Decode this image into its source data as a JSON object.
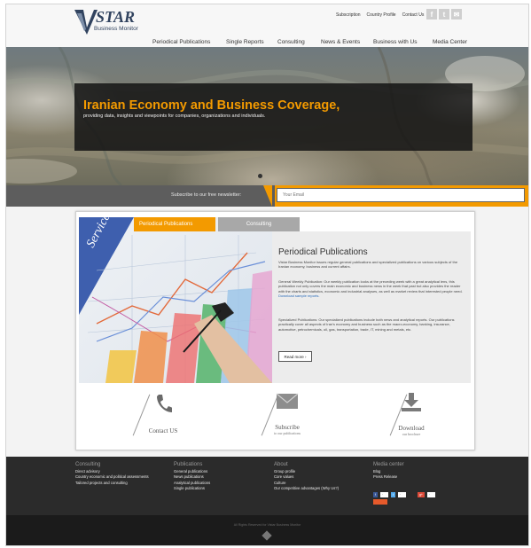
{
  "brand": {
    "logo_text": "STAR",
    "logo_sub": "Business Monitor"
  },
  "top_links": [
    "Subscription",
    "Country Profile",
    "Contact Us"
  ],
  "social_icons": [
    "facebook-icon",
    "twitter-icon",
    "email-icon"
  ],
  "nav": [
    "Periodical Publications",
    "Single Reports",
    "Consulting",
    "News & Events",
    "Business with Us",
    "Media Center"
  ],
  "hero": {
    "title": "Iranian Economy and Business Coverage,",
    "subtitle": "providing data, insights and viewpoints for companies, organizations and individuals."
  },
  "newsletter": {
    "label": "Subscribe to our free newsletter:",
    "placeholder": "Your Email"
  },
  "tabs": [
    "Periodical Publications",
    "Consulting"
  ],
  "services_label": "Services",
  "content": {
    "title": "Periodical Publications",
    "p1": "Vistar Business Monitor issues regular general publications and specialized publications on various subjects of the Iranian economy, business and current affairs.",
    "p2": "General Weekly Publication: Our weekly publication looks at the preceding week with a great analytical lens, this publication not only covers the main economic and business news in the week that past but also provides the reader with the charts and statistics, economic and industrial analyses, as well as market review that interested people need.",
    "p2_link": "Download sample reports.",
    "p3": "Specialized Publications: Our specialized publications include both news and analytical reports. Our publications practically cover all aspects of Iran's economy and business such as the macro-economy, banking, insurance, automotive, petrochemicals, oil, gas, transportation, trade, IT, mining and metals, etc.",
    "read_more": "Read more"
  },
  "bottom_links": [
    {
      "title": "Contact US",
      "sub": ""
    },
    {
      "title": "Subscribe",
      "sub": "to our publications"
    },
    {
      "title": "Download",
      "sub": "our brochure"
    }
  ],
  "footer": {
    "consulting": {
      "head": "Consulting",
      "items": [
        "Direct advisory",
        "Country economic and political assessments",
        "Tailored projects and consulting"
      ]
    },
    "publications": {
      "head": "Publications",
      "items": [
        "General publications",
        "News publications",
        "Analytical publications",
        "Single publications"
      ]
    },
    "about": {
      "head": "About",
      "items": [
        "Group profile",
        "Core values",
        "Culture",
        "Our competitive advantages (Why Us?)"
      ]
    },
    "media": {
      "head": "Media center",
      "items": [
        "Blog",
        "Press Release"
      ]
    },
    "copyright": "All Rights Reserved for Vistar Business Monitor"
  },
  "colors": {
    "accent": "#f39a00",
    "logo": "#31435f",
    "footer": "#2b2b2b"
  }
}
